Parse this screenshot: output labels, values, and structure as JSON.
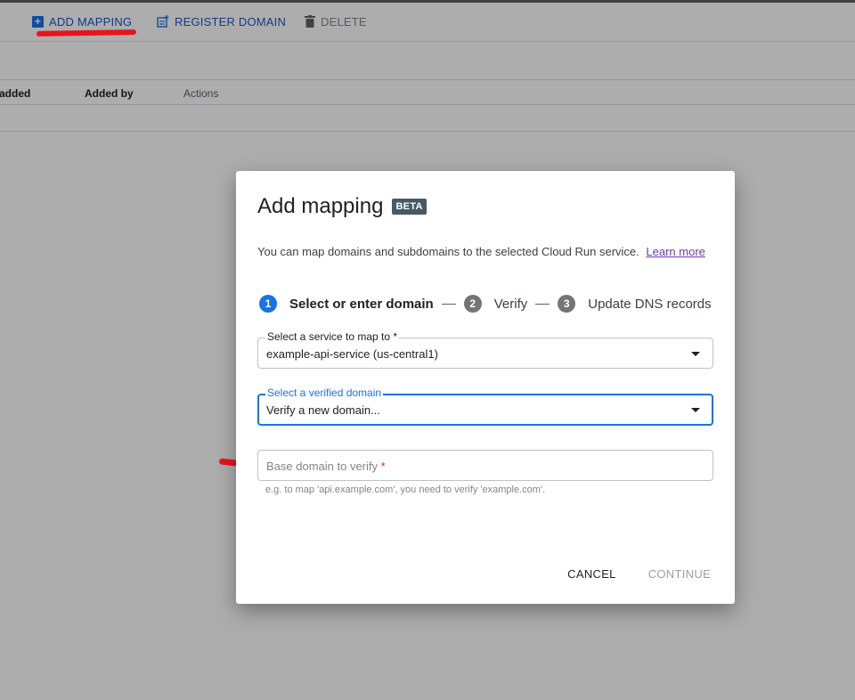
{
  "toolbar": {
    "add_mapping": "ADD MAPPING",
    "register_domain": "REGISTER DOMAIN",
    "delete": "DELETE"
  },
  "table": {
    "columns": [
      "added",
      "Added by",
      "Actions"
    ]
  },
  "dialog": {
    "title": "Add mapping",
    "badge": "BETA",
    "description": "You can map domains and subdomains to the selected Cloud Run service.",
    "learn_more": "Learn more",
    "steps": [
      {
        "number": "1",
        "label": "Select or enter domain",
        "active": true
      },
      {
        "number": "2",
        "label": "Verify",
        "active": false
      },
      {
        "number": "3",
        "label": "Update DNS records",
        "active": false
      }
    ],
    "service_field": {
      "label": "Select a service to map to *",
      "value": "example-api-service (us-central1)"
    },
    "domain_field": {
      "label": "Select a verified domain",
      "value": "Verify a new domain..."
    },
    "base_domain_field": {
      "placeholder": "Base domain to verify",
      "required_mark": "*",
      "hint": "e.g. to map 'api.example.com', you need to verify 'example.com'."
    },
    "cancel": "CANCEL",
    "continue": "CONTINUE"
  },
  "colors": {
    "accent": "#1a73e8",
    "annotation": "#e8141b",
    "beta_badge": "#455a64"
  }
}
